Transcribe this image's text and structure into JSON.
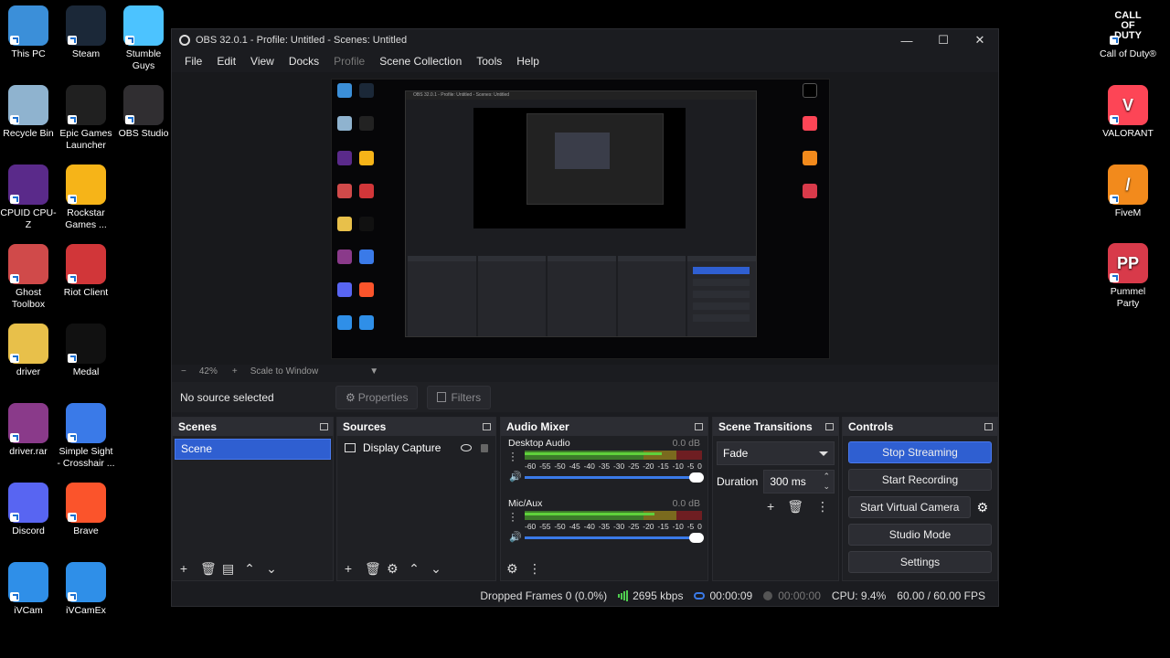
{
  "desktop_left": [
    {
      "label": "This PC",
      "icon": "monitor-icon",
      "color": "#3b8fd9"
    },
    {
      "label": "Steam",
      "icon": "steam-icon",
      "color": "#1b2838"
    },
    {
      "label": "Stumble Guys",
      "icon": "stumble-guys-icon",
      "color": "#4cc3ff"
    },
    {
      "label": "Recycle Bin",
      "icon": "recycle-bin-icon",
      "color": "#8fb3cf"
    },
    {
      "label": "Epic Games Launcher",
      "icon": "epic-games-icon",
      "color": "#202020"
    },
    {
      "label": "OBS Studio",
      "icon": "obs-icon",
      "color": "#302e31"
    },
    {
      "label": "CPUID CPU-Z",
      "icon": "cpu-z-icon",
      "color": "#5a2a8a"
    },
    {
      "label": "Rockstar Games ...",
      "icon": "rockstar-icon",
      "color": "#f6b418"
    },
    {
      "label": "Ghost Toolbox",
      "icon": "ghost-toolbox-icon",
      "color": "#d04a4a"
    },
    {
      "label": "Riot Client",
      "icon": "riot-client-icon",
      "color": "#d13639"
    },
    {
      "label": "driver",
      "icon": "folder-icon",
      "color": "#e8c04a"
    },
    {
      "label": "Medal",
      "icon": "medal-icon",
      "color": "#111111"
    },
    {
      "label": "driver.rar",
      "icon": "winrar-icon",
      "color": "#8a3a8a"
    },
    {
      "label": "Simple Sight - Crosshair ...",
      "icon": "crosshair-icon",
      "color": "#3a7ae8"
    },
    {
      "label": "Discord",
      "icon": "discord-icon",
      "color": "#5865f2"
    },
    {
      "label": "Brave",
      "icon": "brave-icon",
      "color": "#fb542b"
    },
    {
      "label": "iVCam",
      "icon": "ivcam-icon",
      "color": "#2f8fe8"
    },
    {
      "label": "iVCamEx",
      "icon": "ivcamex-icon",
      "color": "#2f8fe8"
    }
  ],
  "desktop_right": [
    {
      "label": "Call of Duty®",
      "icon": "call-of-duty-icon",
      "color": "#000000",
      "text": "CALL OF DUTY"
    },
    {
      "label": "VALORANT",
      "icon": "valorant-icon",
      "color": "#fd4556",
      "text": "V"
    },
    {
      "label": "FiveM",
      "icon": "fivem-icon",
      "color": "#f28a1c",
      "text": "/"
    },
    {
      "label": "Pummel Party",
      "icon": "pummel-party-icon",
      "color": "#d83a4a",
      "text": "PP"
    }
  ],
  "window": {
    "title": "OBS 32.0.1 - Profile: Untitled - Scenes: Untitled",
    "controls": {
      "minimize": "—",
      "maximize": "☐",
      "close": "✕"
    }
  },
  "menu": [
    "File",
    "Edit",
    "View",
    "Docks",
    "Profile",
    "Scene Collection",
    "Tools",
    "Help"
  ],
  "zoom": {
    "minus": "−",
    "value": "42%",
    "plus": "+",
    "mode": "Scale to Window",
    "caret": "▼"
  },
  "source_bar": {
    "no_source": "No source selected",
    "properties": "Properties",
    "filters": "Filters"
  },
  "scenes": {
    "title": "Scenes",
    "items": [
      "Scene"
    ]
  },
  "sources": {
    "title": "Sources",
    "items": [
      "Display Capture"
    ]
  },
  "mixer": {
    "title": "Audio Mixer",
    "ticks": [
      "-60",
      "-55",
      "-50",
      "-45",
      "-40",
      "-35",
      "-30",
      "-25",
      "-20",
      "-15",
      "-10",
      "-5",
      "0"
    ],
    "channels": [
      {
        "name": "Desktop Audio",
        "db": "0.0 dB"
      },
      {
        "name": "Mic/Aux",
        "db": "0.0 dB"
      }
    ]
  },
  "transitions": {
    "title": "Scene Transitions",
    "selected": "Fade",
    "duration_label": "Duration",
    "duration_value": "300 ms"
  },
  "controls": {
    "title": "Controls",
    "stop_streaming": "Stop Streaming",
    "start_recording": "Start Recording",
    "start_virtual_camera": "Start Virtual Camera",
    "studio_mode": "Studio Mode",
    "settings": "Settings"
  },
  "status": {
    "dropped": "Dropped Frames 0 (0.0%)",
    "bitrate": "2695 kbps",
    "stream_time": "00:00:09",
    "rec_time": "00:00:00",
    "cpu": "CPU: 9.4%",
    "fps": "60.00 / 60.00 FPS"
  }
}
